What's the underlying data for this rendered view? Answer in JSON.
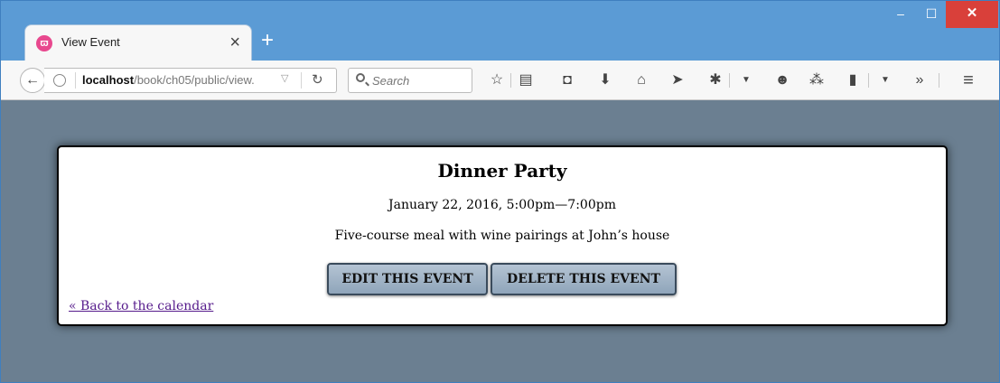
{
  "browser": {
    "tab": {
      "title": "View Event",
      "favicon": "firefox-logo-icon"
    },
    "new_tab_label": "+",
    "window_controls": {
      "minimize": "‒",
      "maximize": "☐",
      "close": "✕"
    },
    "url": {
      "host": "localhost",
      "path": "/book/ch05/public/view."
    },
    "search": {
      "placeholder": "Search"
    },
    "toolbar_icons": [
      "bookmark-star-icon",
      "reading-list-icon",
      "pocket-icon",
      "download-icon",
      "home-icon",
      "send-icon",
      "extension-icon",
      "chat-icon",
      "share-icon",
      "clipboard-icon",
      "overflow-chevron-icon",
      "menu-icon"
    ],
    "overflow_label": "»"
  },
  "event": {
    "title": "Dinner Party",
    "date_range": "January 22, 2016, 5:00pm—7:00pm",
    "description": "Five-course meal with wine pairings at John’s house",
    "edit_label": "EDIT THIS EVENT",
    "delete_label": "DELETE THIS EVENT",
    "back_link": "« Back to the calendar"
  },
  "colors": {
    "chrome_blue": "#5b9bd5",
    "content_bg": "#6b7f91",
    "button_gradient": [
      "#b4c3d3",
      "#8fa5ba"
    ],
    "link": "#551a8b",
    "close_red": "#d9403a"
  }
}
